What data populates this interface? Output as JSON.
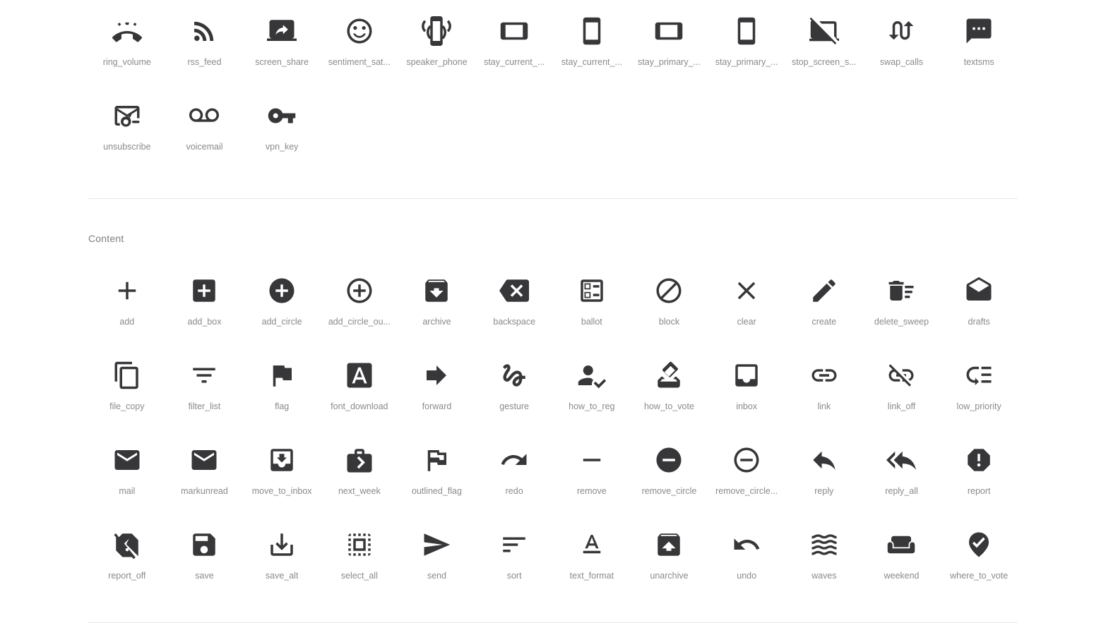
{
  "page": {
    "background": "#ffffff",
    "icon_color": "#37373a",
    "label_color": "#8a8a8a",
    "divider_color": "#e8e8e8"
  },
  "sections": [
    {
      "id": "communication-tail",
      "title": null,
      "icons": [
        {
          "label": "ring_volume",
          "icon": "ring-volume-icon"
        },
        {
          "label": "rss_feed",
          "icon": "rss-feed-icon"
        },
        {
          "label": "screen_share",
          "icon": "screen-share-icon"
        },
        {
          "label": "sentiment_sat...",
          "icon": "sentiment-satisfied-icon"
        },
        {
          "label": "speaker_phone",
          "icon": "speaker-phone-icon"
        },
        {
          "label": "stay_current_...",
          "icon": "stay-current-landscape-icon"
        },
        {
          "label": "stay_current_...",
          "icon": "stay-current-portrait-icon"
        },
        {
          "label": "stay_primary_...",
          "icon": "stay-primary-landscape-icon"
        },
        {
          "label": "stay_primary_...",
          "icon": "stay-primary-portrait-icon"
        },
        {
          "label": "stop_screen_s...",
          "icon": "stop-screen-share-icon"
        },
        {
          "label": "swap_calls",
          "icon": "swap-calls-icon"
        },
        {
          "label": "textsms",
          "icon": "textsms-icon"
        },
        {
          "label": "unsubscribe",
          "icon": "unsubscribe-icon"
        },
        {
          "label": "voicemail",
          "icon": "voicemail-icon"
        },
        {
          "label": "vpn_key",
          "icon": "vpn-key-icon"
        }
      ]
    },
    {
      "id": "content",
      "title": "Content",
      "icons": [
        {
          "label": "add",
          "icon": "add-icon"
        },
        {
          "label": "add_box",
          "icon": "add-box-icon"
        },
        {
          "label": "add_circle",
          "icon": "add-circle-icon"
        },
        {
          "label": "add_circle_ou...",
          "icon": "add-circle-outline-icon"
        },
        {
          "label": "archive",
          "icon": "archive-icon"
        },
        {
          "label": "backspace",
          "icon": "backspace-icon"
        },
        {
          "label": "ballot",
          "icon": "ballot-icon"
        },
        {
          "label": "block",
          "icon": "block-icon"
        },
        {
          "label": "clear",
          "icon": "clear-icon"
        },
        {
          "label": "create",
          "icon": "create-icon"
        },
        {
          "label": "delete_sweep",
          "icon": "delete-sweep-icon"
        },
        {
          "label": "drafts",
          "icon": "drafts-icon"
        },
        {
          "label": "file_copy",
          "icon": "file-copy-icon"
        },
        {
          "label": "filter_list",
          "icon": "filter-list-icon"
        },
        {
          "label": "flag",
          "icon": "flag-icon"
        },
        {
          "label": "font_download",
          "icon": "font-download-icon"
        },
        {
          "label": "forward",
          "icon": "forward-icon"
        },
        {
          "label": "gesture",
          "icon": "gesture-icon"
        },
        {
          "label": "how_to_reg",
          "icon": "how-to-reg-icon"
        },
        {
          "label": "how_to_vote",
          "icon": "how-to-vote-icon"
        },
        {
          "label": "inbox",
          "icon": "inbox-icon"
        },
        {
          "label": "link",
          "icon": "link-icon"
        },
        {
          "label": "link_off",
          "icon": "link-off-icon"
        },
        {
          "label": "low_priority",
          "icon": "low-priority-icon"
        },
        {
          "label": "mail",
          "icon": "mail-icon"
        },
        {
          "label": "markunread",
          "icon": "markunread-icon"
        },
        {
          "label": "move_to_inbox",
          "icon": "move-to-inbox-icon"
        },
        {
          "label": "next_week",
          "icon": "next-week-icon"
        },
        {
          "label": "outlined_flag",
          "icon": "outlined-flag-icon"
        },
        {
          "label": "redo",
          "icon": "redo-icon"
        },
        {
          "label": "remove",
          "icon": "remove-icon"
        },
        {
          "label": "remove_circle",
          "icon": "remove-circle-icon"
        },
        {
          "label": "remove_circle...",
          "icon": "remove-circle-outline-icon"
        },
        {
          "label": "reply",
          "icon": "reply-icon"
        },
        {
          "label": "reply_all",
          "icon": "reply-all-icon"
        },
        {
          "label": "report",
          "icon": "report-icon"
        },
        {
          "label": "report_off",
          "icon": "report-off-icon"
        },
        {
          "label": "save",
          "icon": "save-icon"
        },
        {
          "label": "save_alt",
          "icon": "save-alt-icon"
        },
        {
          "label": "select_all",
          "icon": "select-all-icon"
        },
        {
          "label": "send",
          "icon": "send-icon"
        },
        {
          "label": "sort",
          "icon": "sort-icon"
        },
        {
          "label": "text_format",
          "icon": "text-format-icon"
        },
        {
          "label": "unarchive",
          "icon": "unarchive-icon"
        },
        {
          "label": "undo",
          "icon": "undo-icon"
        },
        {
          "label": "waves",
          "icon": "waves-icon"
        },
        {
          "label": "weekend",
          "icon": "weekend-icon"
        },
        {
          "label": "where_to_vote",
          "icon": "where-to-vote-icon"
        }
      ]
    }
  ]
}
